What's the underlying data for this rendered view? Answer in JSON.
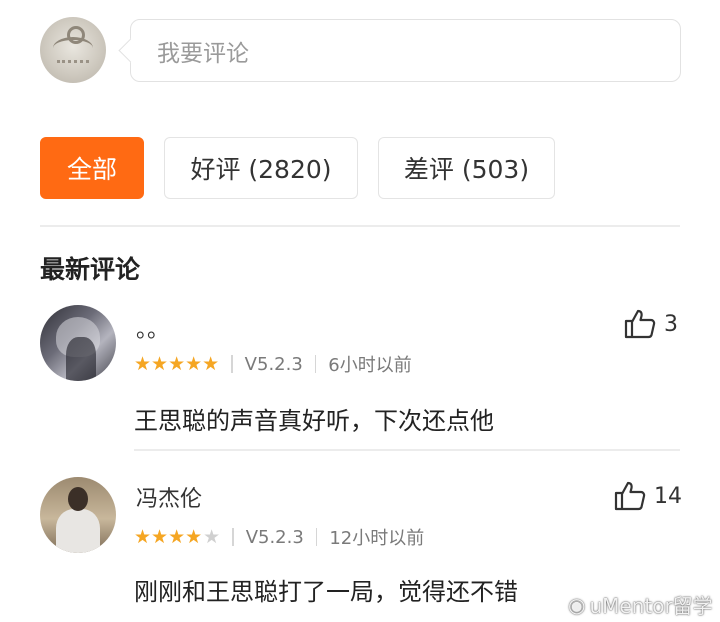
{
  "composer": {
    "placeholder": "我要评论"
  },
  "filters": {
    "all": "全部",
    "good": "好评 (2820)",
    "bad": "差评 (503)"
  },
  "section_title": "最新评论",
  "comments": [
    {
      "username": "。。",
      "rating": 5,
      "stars": "★★★★★",
      "version": "V5.2.3",
      "time": "6小时以前",
      "text": "王思聪的声音真好听，下次还点他",
      "likes": "3"
    },
    {
      "username": "冯杰伦",
      "rating": 4,
      "stars_on": "★★★★",
      "stars_off": "★",
      "version": "V5.2.3",
      "time": "12小时以前",
      "text": "刚刚和王思聪打了一局，觉得还不错",
      "likes": "14"
    }
  ],
  "watermark": {
    "icon": "weibo-icon",
    "text": "uMentor留学"
  },
  "colors": {
    "accent": "#ff6a13",
    "star": "#f5a623"
  }
}
